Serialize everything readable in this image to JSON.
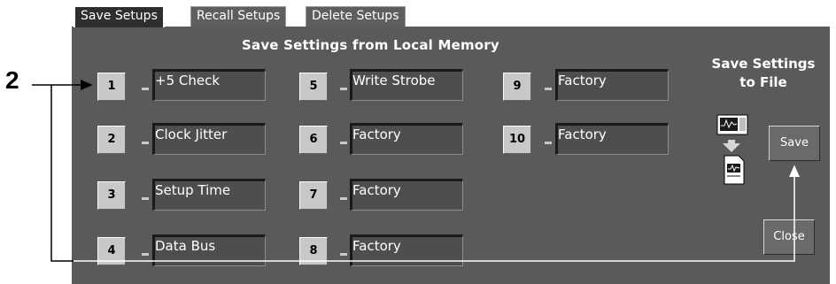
{
  "callout": {
    "label": "2"
  },
  "tabs": [
    {
      "label": "Save Setups",
      "active": true
    },
    {
      "label": "Recall Setups",
      "active": false
    },
    {
      "label": "Delete Setups",
      "active": false
    }
  ],
  "section_title": "Save Settings from Local Memory",
  "file_section": {
    "title_line1": "Save Settings",
    "title_line2": "to File"
  },
  "slots": [
    {
      "number": "1",
      "name": "+5 Check"
    },
    {
      "number": "2",
      "name": "Clock Jitter"
    },
    {
      "number": "3",
      "name": "Setup Time"
    },
    {
      "number": "4",
      "name": "Data Bus"
    },
    {
      "number": "5",
      "name": "Write Strobe"
    },
    {
      "number": "6",
      "name": "Factory"
    },
    {
      "number": "7",
      "name": "Factory"
    },
    {
      "number": "8",
      "name": "Factory"
    },
    {
      "number": "9",
      "name": "Factory"
    },
    {
      "number": "10",
      "name": "Factory"
    }
  ],
  "buttons": {
    "save": "Save",
    "close": "Close"
  },
  "icons": {
    "save_to_file": "scope-to-file-icon"
  },
  "colors": {
    "panel": "#5a5a5a",
    "slot_button": "#c8c8c8",
    "text": "#ffffff"
  }
}
